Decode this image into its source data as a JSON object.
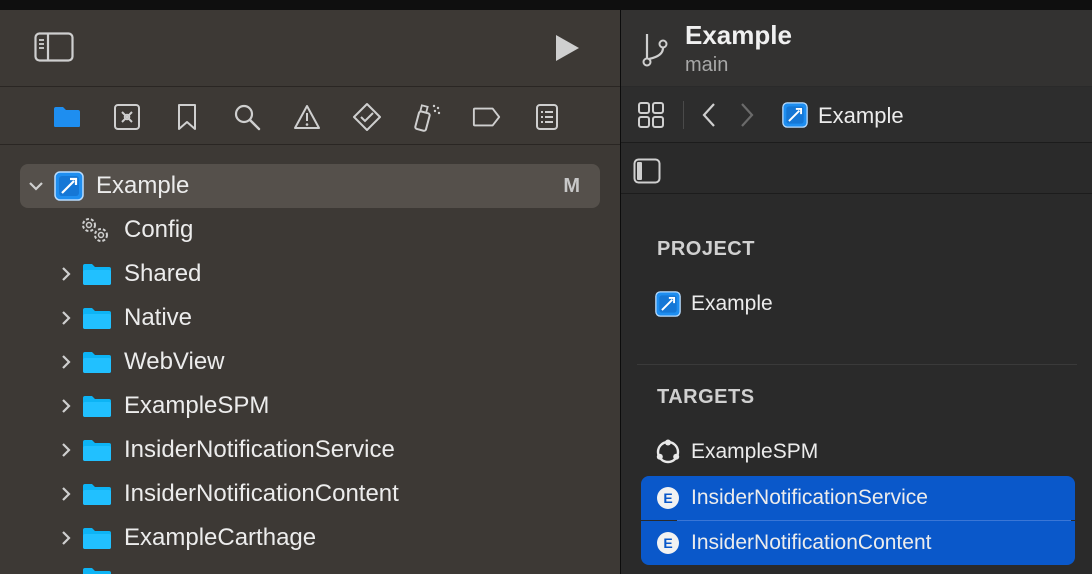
{
  "navigator": {
    "tabs": [
      "folder-icon",
      "x-square-icon",
      "bookmark-icon",
      "search-icon",
      "warning-icon",
      "diamond-check-icon",
      "spray-icon",
      "tag-icon",
      "list-icon"
    ],
    "tree": [
      {
        "label": "Example",
        "badge": "M",
        "expanded": true,
        "icon": "xcode-project-icon"
      },
      {
        "label": "Config",
        "icon": "gears-icon"
      },
      {
        "label": "Shared",
        "icon": "folder-icon"
      },
      {
        "label": "Native",
        "icon": "folder-icon"
      },
      {
        "label": "WebView",
        "icon": "folder-icon"
      },
      {
        "label": "ExampleSPM",
        "icon": "folder-icon"
      },
      {
        "label": "InsiderNotificationService",
        "icon": "folder-icon"
      },
      {
        "label": "InsiderNotificationContent",
        "icon": "folder-icon"
      },
      {
        "label": "ExampleCarthage",
        "icon": "folder-icon"
      }
    ]
  },
  "editor": {
    "title": "Example",
    "branch": "main",
    "jumpbar_label": "Example",
    "project_heading": "PROJECT",
    "project_item": "Example",
    "targets_heading": "TARGETS",
    "targets": [
      {
        "label": "ExampleSPM",
        "icon": "app-target-icon",
        "selected": false
      },
      {
        "label": "InsiderNotificationService",
        "icon": "extension-icon",
        "selected": true
      },
      {
        "label": "InsiderNotificationContent",
        "icon": "extension-icon",
        "selected": true
      }
    ]
  },
  "colors": {
    "accent": "#1e8ef0",
    "selection": "#0a58ca",
    "navigator_bg": "#3d3935"
  }
}
